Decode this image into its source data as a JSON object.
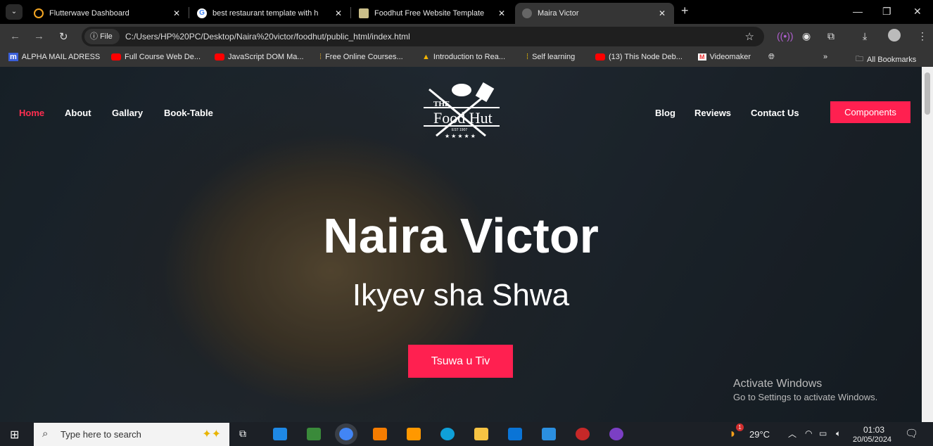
{
  "browser": {
    "tabs": [
      {
        "title": "Flutterwave Dashboard"
      },
      {
        "title": "best restaurant template with h"
      },
      {
        "title": "Foodhut Free Website Template"
      },
      {
        "title": "Maira Victor",
        "active": true
      }
    ],
    "new_tab": "+",
    "url_chip": "File",
    "url": "C:/Users/HP%20PC/Desktop/Naira%20victor/foodhut/public_html/index.html",
    "bookmarks": [
      "ALPHA MAIL ADRESS",
      "Full Course Web De...",
      "JavaScript DOM Ma...",
      "Free Online Courses...",
      "Introduction to Rea...",
      "Self learning",
      "(13) This Node Deb...",
      "Videomaker"
    ],
    "all_bookmarks": "All Bookmarks"
  },
  "site": {
    "nav_left": [
      "Home",
      "About",
      "Gallary",
      "Book-Table"
    ],
    "nav_right": [
      "Blog",
      "Reviews",
      "Contact Us"
    ],
    "components_button": "Components",
    "logo": {
      "the": "THE",
      "name": "Food Hut",
      "est": "EST 1907",
      "stars": "★★★★★"
    },
    "title": "Naira Victor",
    "subtitle": "Ikyev sha Shwa",
    "cta": "Tsuwa u Tiv",
    "accent": "#ff2050"
  },
  "watermark": {
    "line1": "Activate Windows",
    "line2": "Go to Settings to activate Windows."
  },
  "taskbar": {
    "search_placeholder": "Type here to search",
    "weather": "29°C",
    "weather_badge": "1",
    "time": "01:03",
    "date": "20/05/2024"
  }
}
